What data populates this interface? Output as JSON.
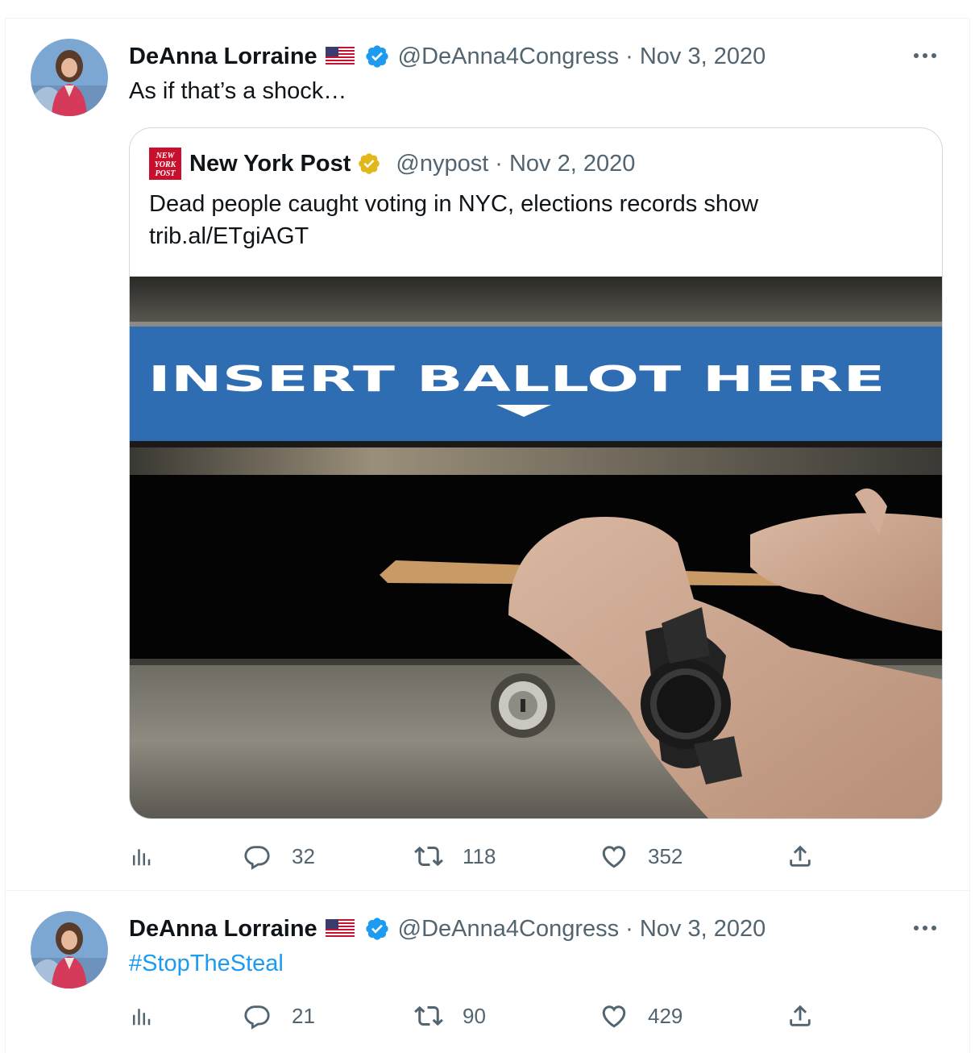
{
  "tweets": [
    {
      "author_name": "DeAnna Lorraine",
      "handle": "@DeAnna4Congress",
      "separator": "·",
      "date": "Nov 3, 2020",
      "text": "As if that’s a shock…",
      "quoted": {
        "author_name": "New York Post",
        "logo_text": [
          "NEW",
          "YORK",
          "POST"
        ],
        "handle": "@nypost",
        "separator": "·",
        "date": "Nov 2, 2020",
        "text_line1": "Dead people caught voting in NYC, elections records show",
        "text_line2": "trib.al/ETgiAGT",
        "image_sign_text": "INSERT BALLOT HERE"
      },
      "stats": {
        "replies": "32",
        "retweets": "118",
        "likes": "352"
      }
    },
    {
      "author_name": "DeAnna Lorraine",
      "handle": "@DeAnna4Congress",
      "separator": "·",
      "date": "Nov 3, 2020",
      "hashtag": "#StopTheSteal",
      "stats": {
        "replies": "21",
        "retweets": "90",
        "likes": "429"
      }
    }
  ],
  "icons": {
    "views": "analytics-icon",
    "reply": "reply-icon",
    "retweet": "retweet-icon",
    "like": "heart-icon",
    "share": "share-icon",
    "more": "more-icon",
    "verified": "verified-badge-icon",
    "flag": "us-flag-icon"
  },
  "colors": {
    "verified_blue": "#1d9bf0",
    "verified_gold": "#e2b719",
    "secondary_text": "#536471",
    "hashtag": "#1d9bf0",
    "sign_blue": "#2f6db3",
    "nypost_red": "#c8102e"
  }
}
